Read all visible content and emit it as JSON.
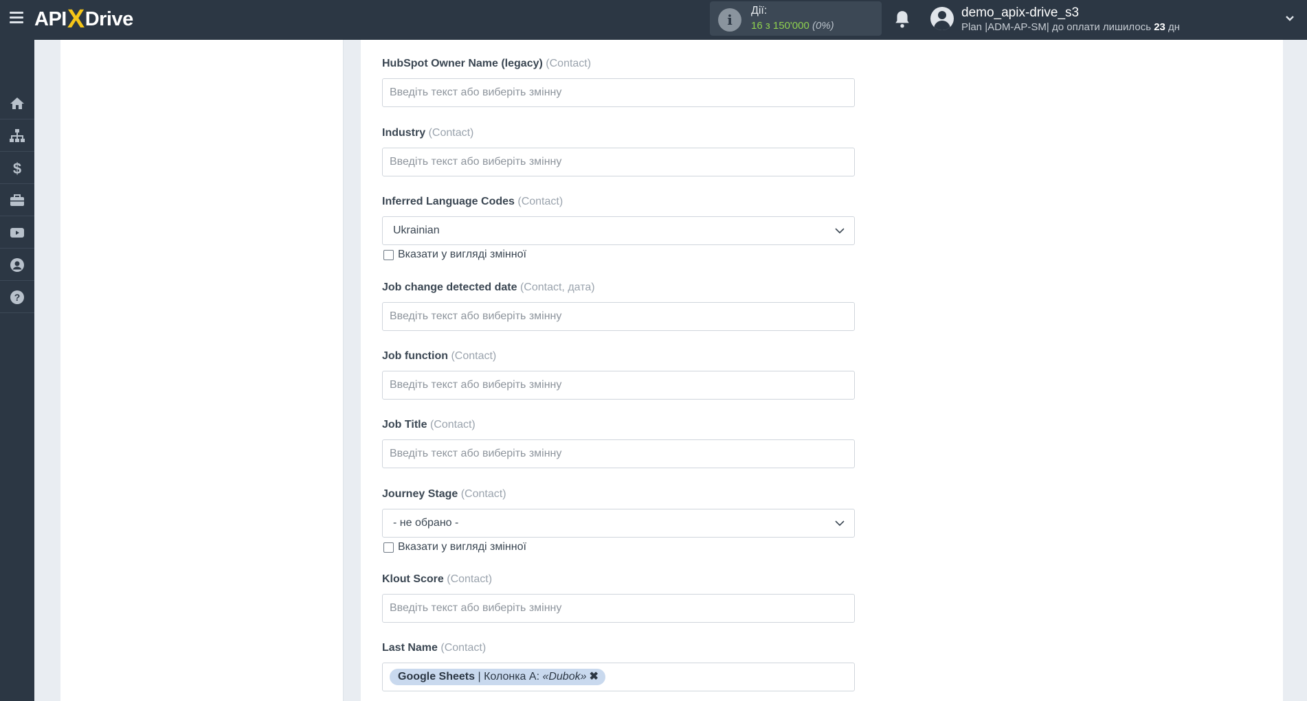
{
  "header": {
    "logo_left": "API",
    "logo_x": "X",
    "logo_right": "Drive",
    "actions_label": "Дії:",
    "actions_count": "16 з 150'000",
    "actions_pct": "(0%)",
    "user_name": "demo_apix-drive_s3",
    "plan_prefix": "Plan |ADM-AP-SM| до оплати лишилось ",
    "plan_days": "23",
    "plan_suffix": " дн"
  },
  "sidebar": {
    "items": [
      {
        "icon": "home-icon"
      },
      {
        "icon": "sitemap-icon"
      },
      {
        "icon": "dollar-icon"
      },
      {
        "icon": "briefcase-icon"
      },
      {
        "icon": "video-icon"
      },
      {
        "icon": "user-circle-icon"
      },
      {
        "icon": "help-icon"
      }
    ]
  },
  "form": {
    "placeholder": "Введіть текст або виберіть змінну",
    "checkbox_label": "Вказати у вигляді змінної",
    "fields": [
      {
        "label": "HubSpot Owner Name (legacy)",
        "hint": "(Contact)"
      },
      {
        "label": "Industry",
        "hint": "(Contact)"
      },
      {
        "label": "Inferred Language Codes",
        "hint": "(Contact)",
        "value": "Ukrainian"
      },
      {
        "label": "Job change detected date",
        "hint": "(Contact, дата)"
      },
      {
        "label": "Job function",
        "hint": "(Contact)"
      },
      {
        "label": "Job Title",
        "hint": "(Contact)"
      },
      {
        "label": "Journey Stage",
        "hint": "(Contact)",
        "value": "- не обрано -"
      },
      {
        "label": "Klout Score",
        "hint": "(Contact)"
      },
      {
        "label": "Last Name",
        "hint": "(Contact)",
        "tag": {
          "source": "Google Sheets",
          "column": " | Колонка А: ",
          "value": "«Dubok»",
          "remove": "✖"
        }
      }
    ]
  }
}
